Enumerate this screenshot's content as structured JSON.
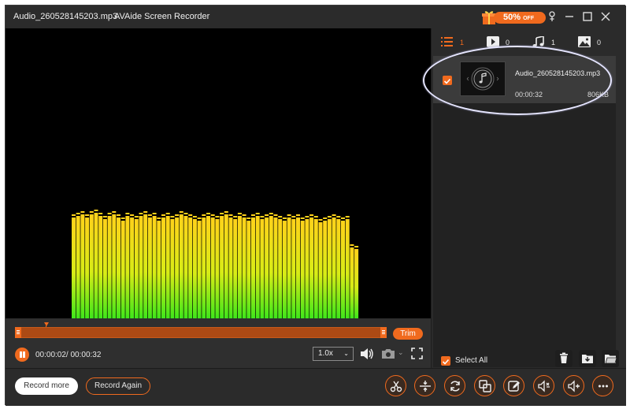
{
  "titlebar": {
    "file_name": "Audio_260528145203.mp3",
    "app_name": "AVAide Screen Recorder",
    "promo": {
      "percent": "50%",
      "off": "OFF"
    }
  },
  "player": {
    "time_display": "00:00:02/ 00:00:32",
    "speed": "1.0x",
    "trim_label": "Trim"
  },
  "tabs": [
    {
      "name": "all",
      "count": "1"
    },
    {
      "name": "video",
      "count": "0"
    },
    {
      "name": "audio",
      "count": "1"
    },
    {
      "name": "image",
      "count": "0"
    }
  ],
  "files": [
    {
      "name": "Audio_260528145203.mp3",
      "duration": "00:00:32",
      "size": "806KB",
      "checked": true
    }
  ],
  "footer": {
    "select_all": "Select All",
    "record_more": "Record more",
    "record_again": "Record Again"
  },
  "tools": [
    "trim",
    "split",
    "convert",
    "merge",
    "edit",
    "compress",
    "volume",
    "more"
  ],
  "colors": {
    "accent": "#f06a1e",
    "background": "#2b2b2b",
    "preview": "#000000"
  }
}
